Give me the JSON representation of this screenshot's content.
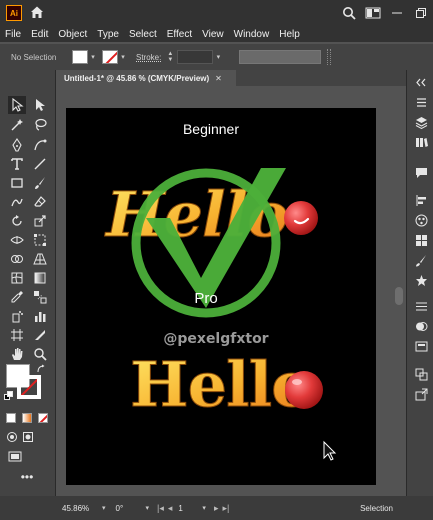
{
  "app": {
    "logo_label": "Ai"
  },
  "menu": [
    "File",
    "Edit",
    "Object",
    "Type",
    "Select",
    "Effect",
    "View",
    "Window",
    "Help"
  ],
  "control_bar": {
    "selection_state": "No Selection",
    "stroke_label": "Stroke:"
  },
  "document_tab": {
    "title": "Untitled-1* @ 45.86 % (CMYK/Preview)",
    "close_label": "✕"
  },
  "artboard": {
    "caption_top": "Beginner",
    "headline_top": "Hello",
    "badge_label": "Pro",
    "watermark": "@pexelgfxtor",
    "headline_bottom": "Hello"
  },
  "status": {
    "zoom": "45.86%",
    "rotation": "0°",
    "artboard_number": "1",
    "tool_name": "Selection"
  },
  "colors": {
    "accent_check": "#4caf3a",
    "hello_start": "#ffd54a",
    "hello_end": "#e8741a",
    "red_circle": "#e23a3a"
  }
}
